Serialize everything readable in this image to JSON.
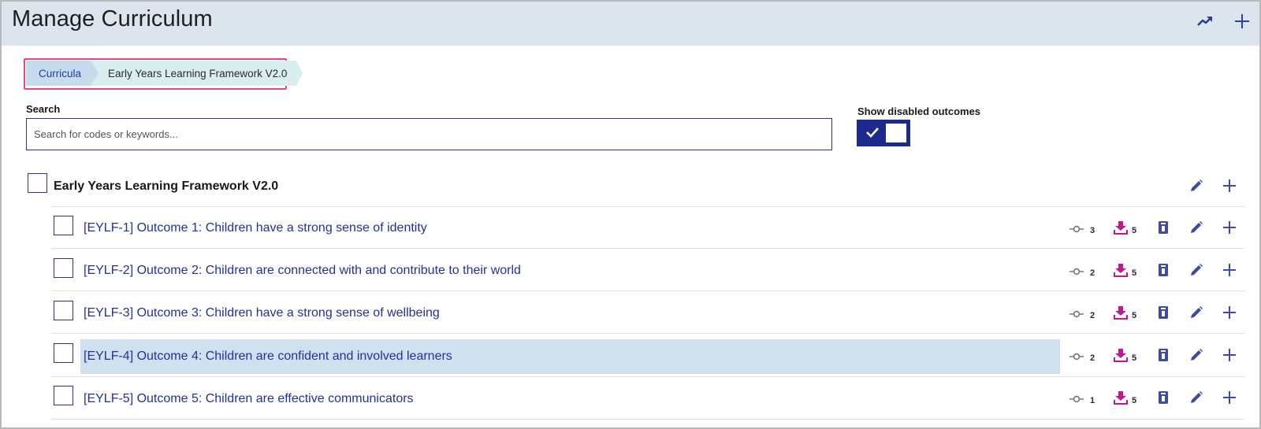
{
  "header": {
    "title": "Manage Curriculum",
    "icons": [
      "trend-up-icon",
      "plus-icon"
    ]
  },
  "breadcrumb": {
    "items": [
      "Curricula",
      "Early Years Learning Framework V2.0"
    ]
  },
  "search": {
    "label": "Search",
    "placeholder": "Search for codes or keywords..."
  },
  "toggle": {
    "label": "Show disabled outcomes",
    "checked": true
  },
  "curriculum": {
    "title": "Early Years Learning Framework V2.0",
    "outcomes": [
      {
        "label": "[EYLF-1] Outcome 1: Children have a strong sense of identity",
        "links": "3",
        "imports": "5"
      },
      {
        "label": "[EYLF-2] Outcome 2: Children are connected with and contribute to their world",
        "links": "2",
        "imports": "5"
      },
      {
        "label": "[EYLF-3] Outcome 3: Children have a strong sense of wellbeing",
        "links": "2",
        "imports": "5"
      },
      {
        "label": "[EYLF-4] Outcome 4: Children are confident and involved learners",
        "links": "2",
        "imports": "5",
        "highlighted": true
      },
      {
        "label": "[EYLF-5] Outcome 5: Children are effective communicators",
        "links": "1",
        "imports": "5"
      }
    ]
  },
  "colors": {
    "header_bg": "#dce5ed",
    "accent": "#1b2a8c",
    "link": "#22319a",
    "import_icon": "#c2188f",
    "highlight": "#cfe0ee",
    "breadcrumb_border": "#e5497a"
  }
}
